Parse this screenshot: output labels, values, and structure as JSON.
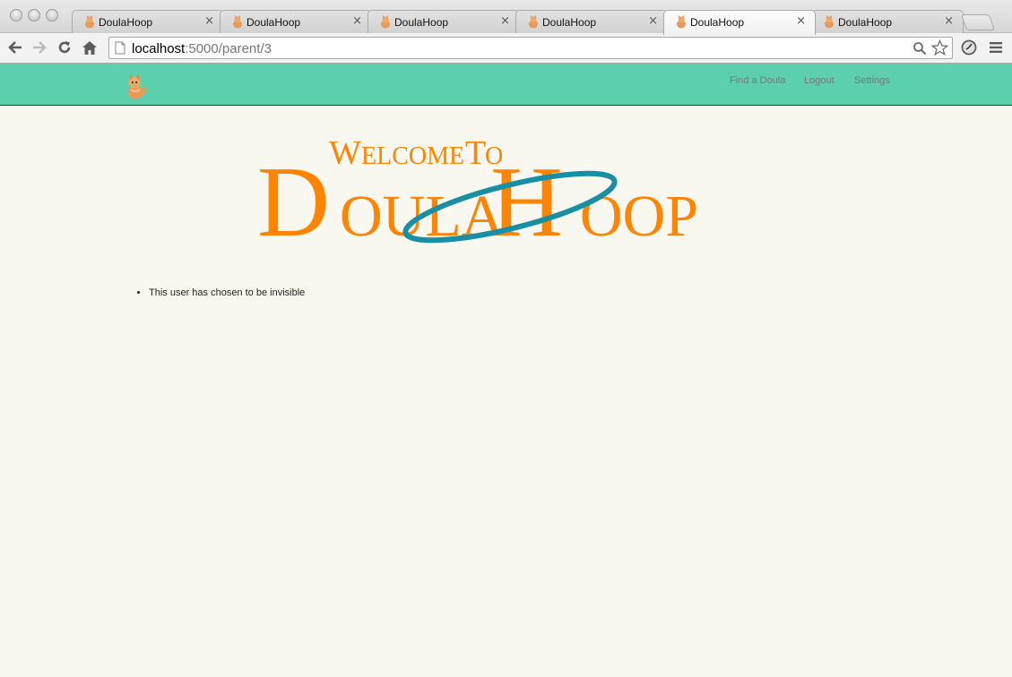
{
  "browser": {
    "tabs": [
      {
        "title": "DoulaHoop",
        "active": false
      },
      {
        "title": "DoulaHoop",
        "active": false
      },
      {
        "title": "DoulaHoop",
        "active": false
      },
      {
        "title": "DoulaHoop",
        "active": false
      },
      {
        "title": "DoulaHoop",
        "active": true
      },
      {
        "title": "DoulaHoop",
        "active": false
      }
    ],
    "close_glyph": "×",
    "url_host": "localhost",
    "url_rest": ":5000/parent/3"
  },
  "navbar": {
    "brand_icon": "kitten-icon",
    "links": [
      "Find a Doula",
      "Logout",
      "Settings"
    ],
    "bg_color": "#5ccfad"
  },
  "logo": {
    "line1": "Welcome To",
    "line2": "DoulaHoop",
    "text_color": "#ff8400",
    "hoop_color": "#1a8fa3"
  },
  "main": {
    "notices": [
      "This user has chosen to be invisible"
    ]
  }
}
